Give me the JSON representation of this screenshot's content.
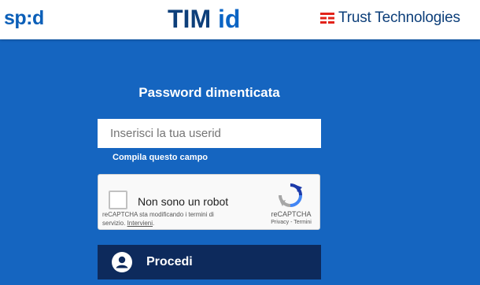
{
  "header": {
    "spid_logo": "sp:d",
    "tim_logo_main": "TIM",
    "tim_logo_id": " id",
    "trust_name": "Trust Technologies"
  },
  "form": {
    "title": "Password dimenticata",
    "userid_placeholder": "Inserisci la tua userid",
    "validation_message": "Compila questo campo",
    "captcha": {
      "label": "Non sono un robot",
      "note_text": "reCAPTCHA sta modificando i termini di servizio. ",
      "note_link": "Intervieni",
      "note_end": ".",
      "brand": "reCAPTCHA",
      "privacy": "Privacy",
      "separator": " - ",
      "terms": "Termini"
    },
    "proceed_label": "Procedi"
  },
  "colors": {
    "brand_blue": "#1565c0",
    "button_navy": "#0d2a5c",
    "trust_red": "#e2231a",
    "placeholder_red": "#e0473e"
  },
  "icons": {
    "trust": "trust-technologies-icon",
    "recaptcha": "recaptcha-logo-icon",
    "avatar": "user-avatar-icon"
  }
}
